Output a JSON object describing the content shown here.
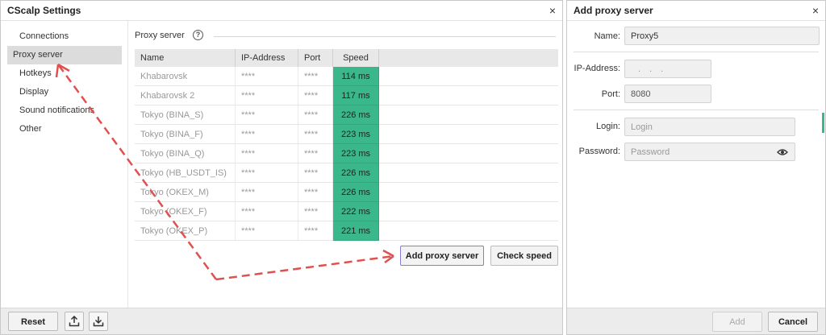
{
  "main_window": {
    "title": "CScalp Settings",
    "close_label": "×",
    "sidebar": {
      "items": [
        {
          "label": "Connections",
          "active": false
        },
        {
          "label": "Proxy server",
          "active": true
        },
        {
          "label": "Hotkeys",
          "active": false
        },
        {
          "label": "Display",
          "active": false
        },
        {
          "label": "Sound notifications",
          "active": false
        },
        {
          "label": "Other",
          "active": false
        }
      ]
    },
    "section": {
      "title": "Proxy server",
      "help_icon": "?"
    },
    "table": {
      "columns": [
        "Name",
        "IP-Address",
        "Port",
        "Speed"
      ],
      "rows": [
        {
          "name": "Khabarovsk",
          "ip": "****",
          "port": "****",
          "speed": "114 ms"
        },
        {
          "name": "Khabarovsk 2",
          "ip": "****",
          "port": "****",
          "speed": "117 ms"
        },
        {
          "name": "Tokyo (BINA_S)",
          "ip": "****",
          "port": "****",
          "speed": "226 ms"
        },
        {
          "name": "Tokyo (BINA_F)",
          "ip": "****",
          "port": "****",
          "speed": "223 ms"
        },
        {
          "name": "Tokyo (BINA_Q)",
          "ip": "****",
          "port": "****",
          "speed": "223 ms"
        },
        {
          "name": "Tokyo (HB_USDT_IS)",
          "ip": "****",
          "port": "****",
          "speed": "226 ms"
        },
        {
          "name": "Tokyo (OKEX_M)",
          "ip": "****",
          "port": "****",
          "speed": "226 ms"
        },
        {
          "name": "Tokyo (OKEX_F)",
          "ip": "****",
          "port": "****",
          "speed": "222 ms"
        },
        {
          "name": "Tokyo (OKEX_P)",
          "ip": "****",
          "port": "****",
          "speed": "221 ms"
        }
      ]
    },
    "buttons": {
      "add_proxy": "Add proxy server",
      "check_speed": "Check speed"
    },
    "footer": {
      "reset": "Reset",
      "upload_icon": "upload-icon",
      "download_icon": "download-icon"
    }
  },
  "proxy_dialog": {
    "title": "Add proxy server",
    "close_label": "×",
    "fields": {
      "name_label": "Name:",
      "name_value": "Proxy5",
      "ip_label": "IP-Address:",
      "ip_value": ". . .",
      "port_label": "Port:",
      "port_value": "8080",
      "login_label": "Login:",
      "login_placeholder": "Login",
      "password_label": "Password:",
      "password_placeholder": "Password",
      "eye_icon": "eye-icon"
    },
    "footer": {
      "add": "Add",
      "cancel": "Cancel"
    }
  },
  "colors": {
    "speed_green": "#3ab78b",
    "arrow_red": "#e05050",
    "focus_border": "#8a7bd4"
  }
}
